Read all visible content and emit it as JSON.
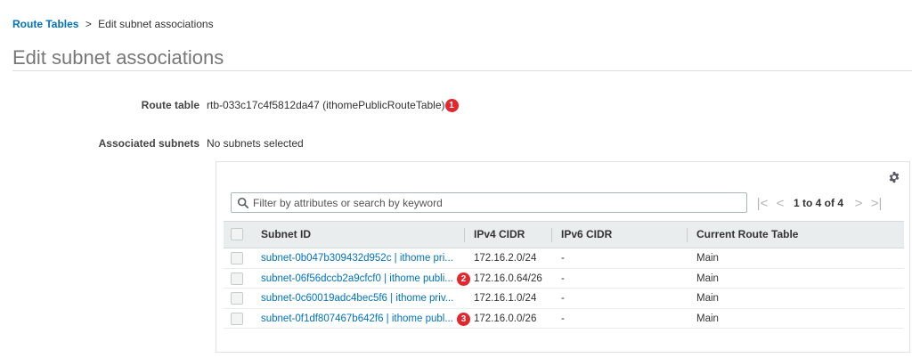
{
  "breadcrumb": {
    "parent": "Route Tables",
    "separator": ">",
    "current": "Edit subnet associations"
  },
  "page_title": "Edit subnet associations",
  "fields": {
    "route_table_label": "Route table",
    "route_table_value": "rtb-033c17c4f5812da47 (ithomePublicRouteTable)",
    "associated_subnets_label": "Associated subnets",
    "associated_subnets_value": "No subnets selected"
  },
  "annotations": {
    "badge_1": "1",
    "badge_2": "2",
    "badge_3": "3"
  },
  "search": {
    "placeholder": "Filter by attributes or search by keyword"
  },
  "pagination": {
    "text": "1 to 4 of 4",
    "first": "|<",
    "prev": "<",
    "next": ">",
    "last": ">|"
  },
  "table": {
    "headers": {
      "subnet_id": "Subnet ID",
      "ipv4": "IPv4 CIDR",
      "ipv6": "IPv6 CIDR",
      "route_table": "Current Route Table"
    },
    "rows": [
      {
        "subnet": "subnet-0b047b309432d952c | ithome pri...",
        "ipv4": "172.16.2.0/24",
        "ipv6": "-",
        "route_table": "Main"
      },
      {
        "subnet": "subnet-06f56dccb2a9cfcf0 | ithome publi...",
        "ipv4": "172.16.0.64/26",
        "ipv6": "-",
        "route_table": "Main"
      },
      {
        "subnet": "subnet-0c60019adc4bec5f6 | ithome priv...",
        "ipv4": "172.16.1.0/24",
        "ipv6": "-",
        "route_table": "Main"
      },
      {
        "subnet": "subnet-0f1df807467b642f6 | ithome publ...",
        "ipv4": "172.16.0.0/26",
        "ipv6": "-",
        "route_table": "Main"
      }
    ]
  },
  "colors": {
    "link": "#0073bb",
    "badge": "#e4272d",
    "header_bg": "#eaeded"
  }
}
